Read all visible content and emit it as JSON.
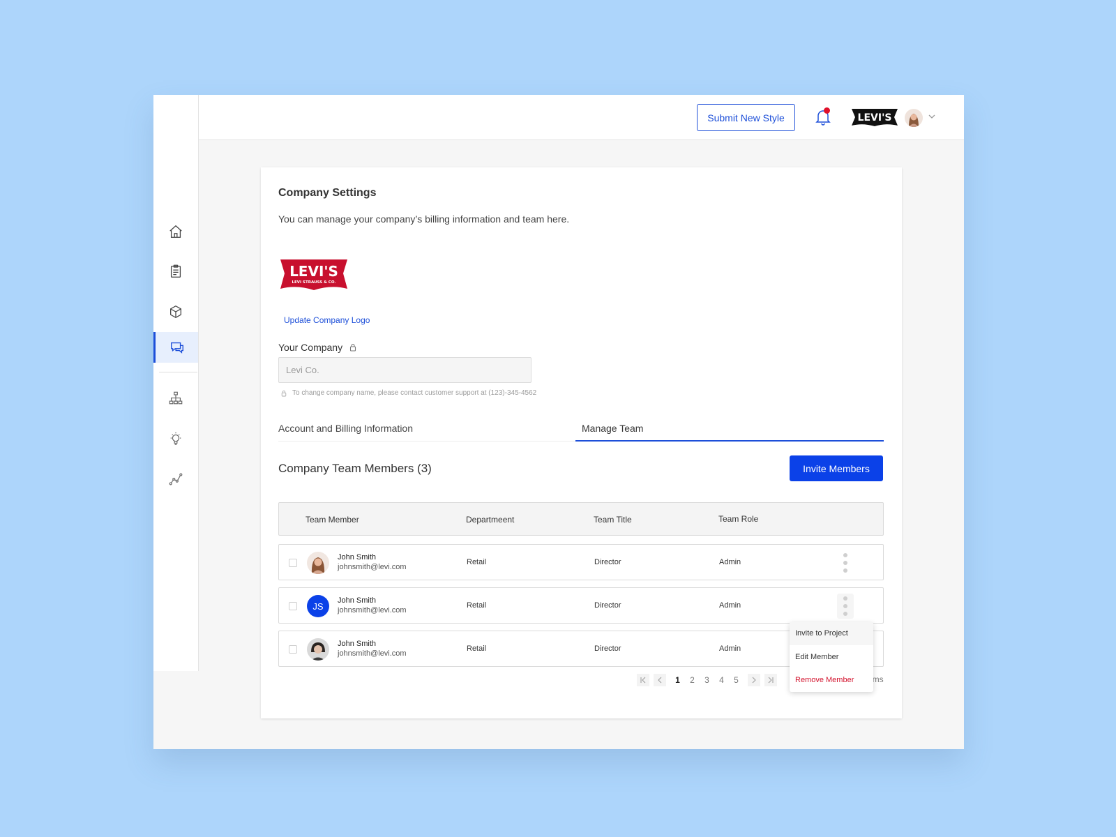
{
  "topbar": {
    "submit_label": "Submit New Style",
    "brand": "Levi's"
  },
  "sidebar": {
    "items": [
      {
        "icon": "home-icon"
      },
      {
        "icon": "clipboard-icon"
      },
      {
        "icon": "box-icon"
      },
      {
        "icon": "chat-icon",
        "active": true
      },
      {
        "icon": "hierarchy-icon"
      },
      {
        "icon": "lightbulb-icon"
      },
      {
        "icon": "trend-icon"
      }
    ]
  },
  "settings": {
    "title": "Company Settings",
    "subtitle": "You can manage your company’s billing information and team here.",
    "logo_text": "Levi's",
    "logo_subtext": "LEVI STRAUSS & CO.",
    "update_logo_label": "Update Company Logo",
    "company_label": "Your Company",
    "company_value": "Levi Co.",
    "hint": "To change company name, please contact customer support at (123)-345-4562"
  },
  "tabs": [
    {
      "label": "Account and Billing Information",
      "active": false
    },
    {
      "label": "Manage Team",
      "active": true
    }
  ],
  "team": {
    "heading": "Company Team Members (3)",
    "invite_label": "Invite Members",
    "columns": [
      "Team Member",
      "Departmeent",
      "Team Title",
      "Team Role"
    ],
    "rows": [
      {
        "name": "John Smith",
        "email": "johnsmith@levi.com",
        "department": "Retail",
        "title": "Director",
        "role": "Admin",
        "avatar": "photo"
      },
      {
        "name": "John Smith",
        "email": "johnsmith@levi.com",
        "department": "Retail",
        "title": "Director",
        "role": "Admin",
        "avatar": "initials",
        "initials": "JS"
      },
      {
        "name": "John Smith",
        "email": "johnsmith@levi.com",
        "department": "Retail",
        "title": "Director",
        "role": "Admin",
        "avatar": "photo"
      }
    ]
  },
  "pagination": {
    "pages": [
      "1",
      "2",
      "3",
      "4",
      "5"
    ],
    "current": "1",
    "items_label": "ems"
  },
  "row_menu": {
    "items": [
      "Invite to Project",
      "Edit Member",
      "Remove Member"
    ]
  },
  "colors": {
    "accent": "#0b41e8",
    "danger": "#d3142e",
    "background": "#add5fb"
  }
}
